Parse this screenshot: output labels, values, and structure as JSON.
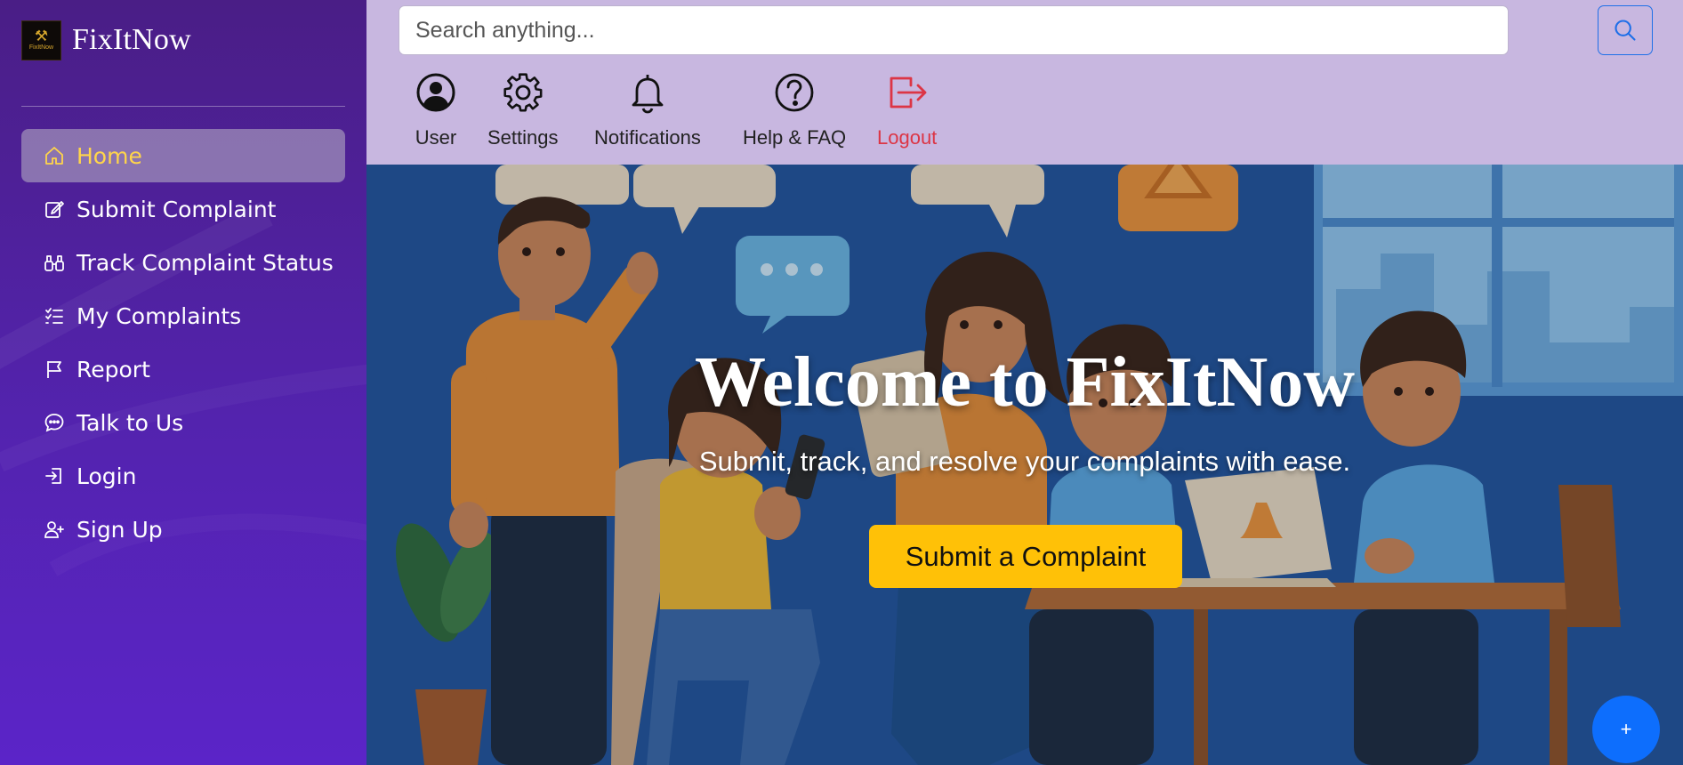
{
  "brand": {
    "name": "FixItNow",
    "logo_text": "FixItNow"
  },
  "sidebar": {
    "items": [
      {
        "label": "Home",
        "icon": "home-icon",
        "active": true
      },
      {
        "label": "Submit Complaint",
        "icon": "edit-icon",
        "active": false
      },
      {
        "label": "Track Complaint Status",
        "icon": "binoculars-icon",
        "active": false
      },
      {
        "label": "My Complaints",
        "icon": "list-check-icon",
        "active": false
      },
      {
        "label": "Report",
        "icon": "flag-icon",
        "active": false
      },
      {
        "label": "Talk to Us",
        "icon": "chat-dots-icon",
        "active": false
      },
      {
        "label": "Login",
        "icon": "login-icon",
        "active": false
      },
      {
        "label": "Sign Up",
        "icon": "person-plus-icon",
        "active": false
      }
    ]
  },
  "search": {
    "placeholder": "Search anything...",
    "value": ""
  },
  "toolbar": {
    "items": [
      {
        "label": "User",
        "icon": "user-circle-icon"
      },
      {
        "label": "Settings",
        "icon": "gear-icon"
      },
      {
        "label": "Notifications",
        "icon": "bell-icon"
      },
      {
        "label": "Help & FAQ",
        "icon": "question-circle-icon"
      },
      {
        "label": "Logout",
        "icon": "logout-icon"
      }
    ]
  },
  "hero": {
    "title": "Welcome to FixItNow",
    "subtitle": "Submit, track, and resolve your complaints with ease.",
    "cta_label": "Submit a Complaint"
  },
  "fab": {
    "label": "+"
  },
  "colors": {
    "sidebar_top": "#4a1e86",
    "sidebar_bottom": "#5b24c8",
    "active_text": "#ffd54a",
    "topbar": "#c8b7e0",
    "search_accent": "#1e6fe8",
    "logout": "#dc3545",
    "cta": "#ffc107",
    "fab": "#0d6efd"
  }
}
